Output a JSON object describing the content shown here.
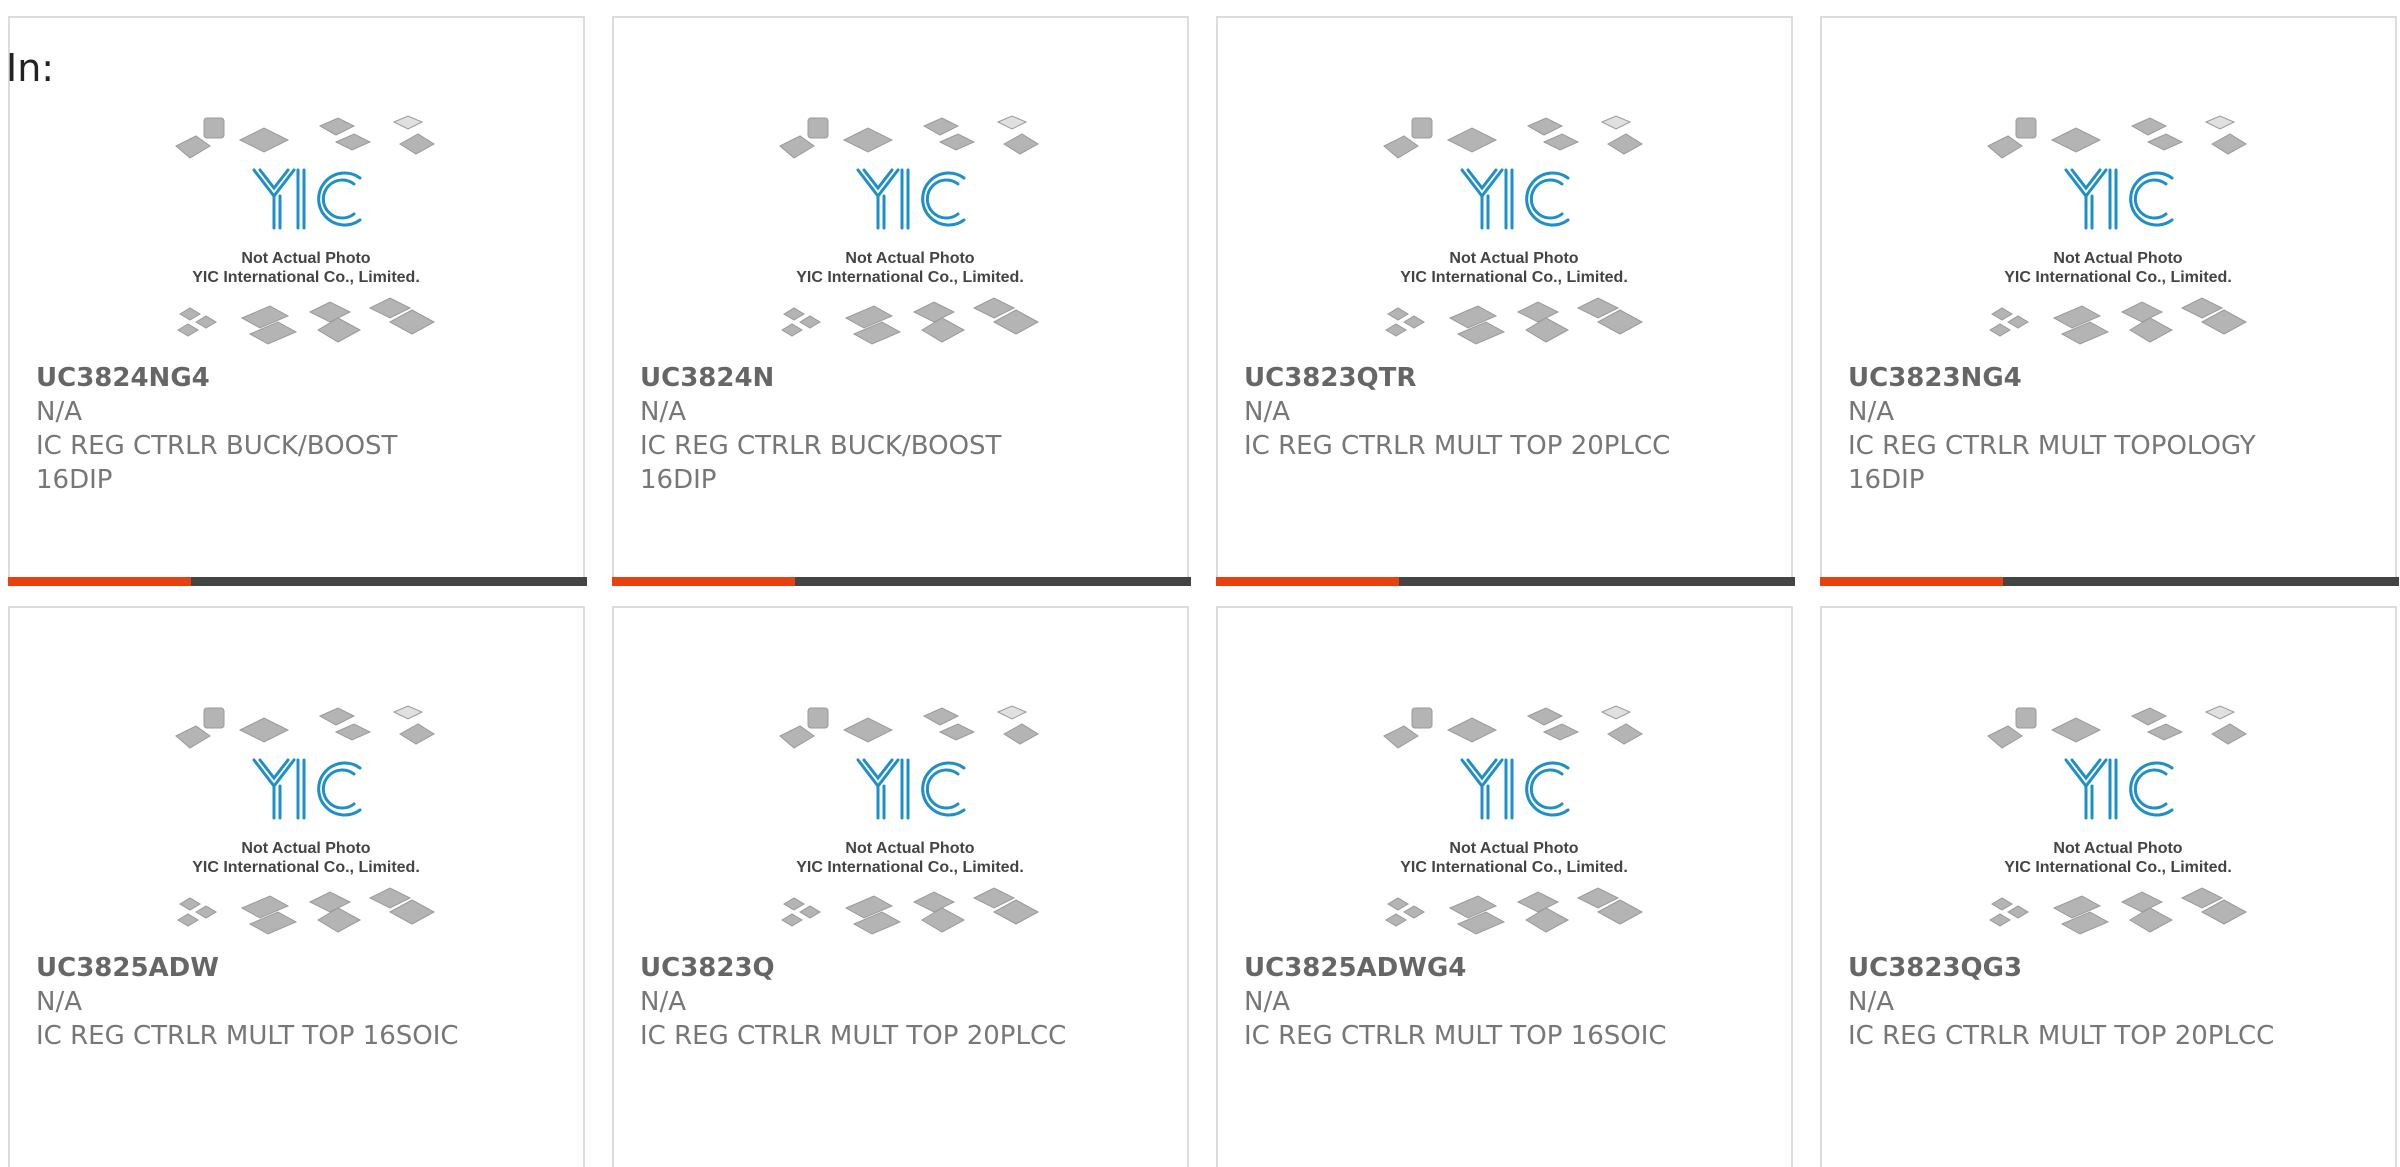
{
  "header": {
    "in_label": "In:"
  },
  "colors": {
    "accent": "#e8410f",
    "bar": "#444444",
    "logo_blue": "#1e8fc8"
  },
  "placeholder": {
    "line1": "Not Actual Photo",
    "line2": "YIC International Co., Limited.",
    "logo_text": "YIC"
  },
  "products": [
    {
      "part": "UC3824NG4",
      "mfr": "N/A",
      "desc1": "IC REG CTRLR BUCK/BOOST",
      "desc2": "16DIP"
    },
    {
      "part": "UC3824N",
      "mfr": "N/A",
      "desc1": "IC REG CTRLR BUCK/BOOST",
      "desc2": "16DIP"
    },
    {
      "part": "UC3823QTR",
      "mfr": "N/A",
      "desc1": "IC REG CTRLR MULT TOP 20PLCC",
      "desc2": ""
    },
    {
      "part": "UC3823NG4",
      "mfr": "N/A",
      "desc1": "IC REG CTRLR MULT TOPOLOGY",
      "desc2": "16DIP"
    },
    {
      "part": "UC3825ADW",
      "mfr": "N/A",
      "desc1": "IC REG CTRLR MULT TOP 16SOIC",
      "desc2": ""
    },
    {
      "part": "UC3823Q",
      "mfr": "N/A",
      "desc1": "IC REG CTRLR MULT TOP 20PLCC",
      "desc2": ""
    },
    {
      "part": "UC3825ADWG4",
      "mfr": "N/A",
      "desc1": "IC REG CTRLR MULT TOP 16SOIC",
      "desc2": ""
    },
    {
      "part": "UC3823QG3",
      "mfr": "N/A",
      "desc1": "IC REG CTRLR MULT TOP 20PLCC",
      "desc2": ""
    }
  ]
}
